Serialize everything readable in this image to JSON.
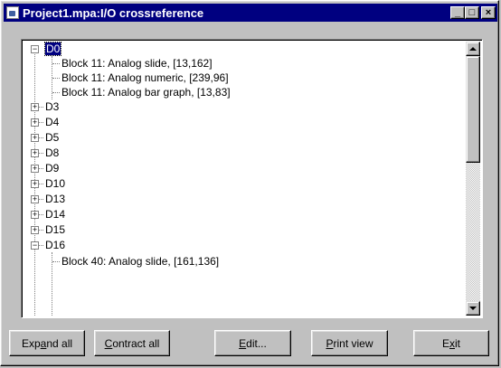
{
  "window": {
    "title": "Project1.mpa:I/O crossreference",
    "minimize": "_",
    "maximize": "□",
    "close": "×"
  },
  "tree": {
    "root_selected": "D0",
    "d0_children": [
      "Block 11: Analog slide, [13,162]",
      "Block 11: Analog numeric, [239,96]",
      "Block 11: Analog bar graph, [13,83]"
    ],
    "collapsed_nodes": [
      "D3",
      "D4",
      "D5",
      "D8",
      "D9",
      "D10",
      "D13",
      "D14",
      "D15"
    ],
    "expanded_node": "D16",
    "d16_partial_child": "Block 40: Analog slide, [161,136]"
  },
  "buttons": {
    "expand_all_pre": "Exp",
    "expand_all_u": "a",
    "expand_all_post": "nd all",
    "contract_all_u": "C",
    "contract_all_post": "ontract all",
    "edit_u": "E",
    "edit_post": "dit...",
    "print_u": "P",
    "print_post": "rint view",
    "exit_pre": "E",
    "exit_u": "x",
    "exit_post": "it"
  }
}
